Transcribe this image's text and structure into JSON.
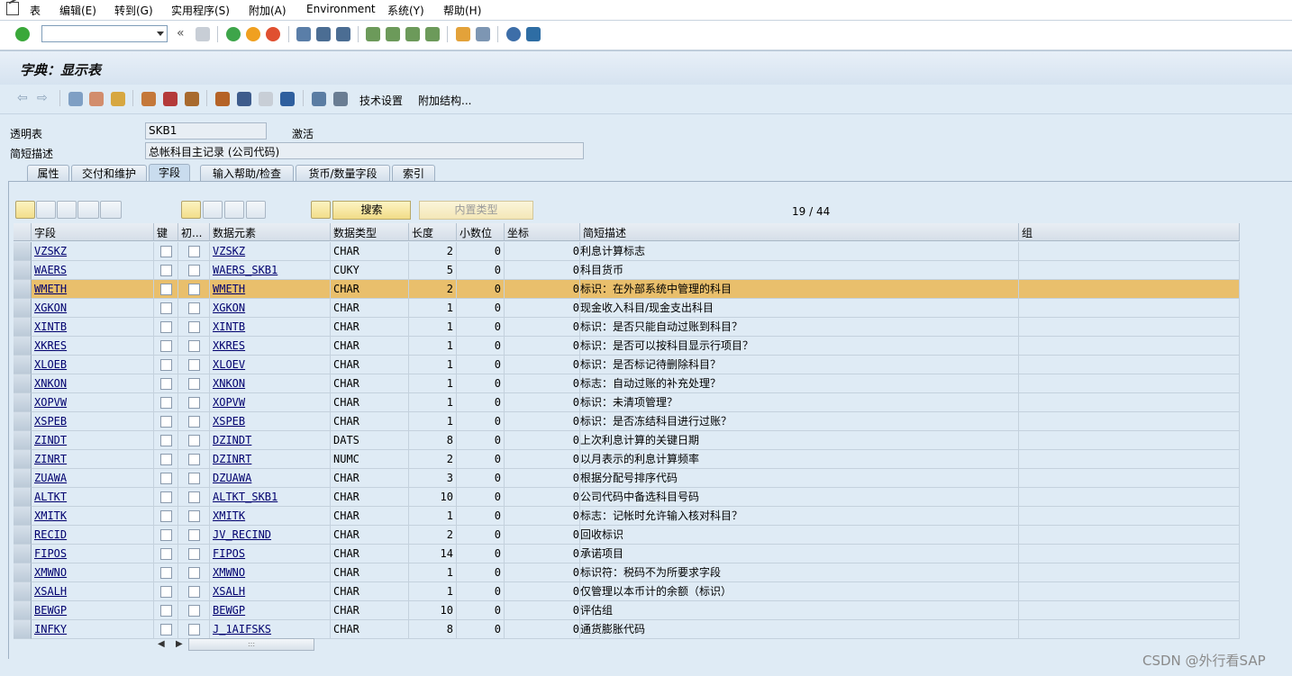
{
  "menubar": {
    "items": [
      "表",
      "编辑(E)",
      "转到(G)",
      "实用程序(S)",
      "附加(A)",
      "Environment",
      "系统(Y)",
      "帮助(H)"
    ]
  },
  "title": "字典：显示表",
  "app_toolbar": {
    "tech_settings": "技术设置",
    "append_struct": "附加结构..."
  },
  "header": {
    "table_label": "透明表",
    "table_value": "SKB1",
    "status": "激活",
    "desc_label": "简短描述",
    "desc_value": "总帐科目主记录 (公司代码)"
  },
  "tabs": [
    "属性",
    "交付和维护",
    "字段",
    "输入帮助/检查",
    "货币/数量字段",
    "索引"
  ],
  "active_tab": "字段",
  "table_toolbar": {
    "search": "搜索",
    "builtin_type": "内置类型",
    "counter": "19 / 44"
  },
  "columns": [
    "字段",
    "键",
    "初...",
    "数据元素",
    "数据类型",
    "长度",
    "小数位",
    "坐标",
    "简短描述",
    "组"
  ],
  "rows": [
    {
      "field": "VZSKZ",
      "element": "VZSKZ",
      "type": "CHAR",
      "len": "2",
      "dec": "0",
      "coord": "0",
      "desc": "利息计算标志"
    },
    {
      "field": "WAERS",
      "element": "WAERS_SKB1",
      "type": "CUKY",
      "len": "5",
      "dec": "0",
      "coord": "0",
      "desc": "科目货币"
    },
    {
      "field": "WMETH",
      "element": "WMETH",
      "type": "CHAR",
      "len": "2",
      "dec": "0",
      "coord": "0",
      "desc": "标识：在外部系统中管理的科目",
      "selected": true
    },
    {
      "field": "XGKON",
      "element": "XGKON",
      "type": "CHAR",
      "len": "1",
      "dec": "0",
      "coord": "0",
      "desc": "现金收入科目/现金支出科目"
    },
    {
      "field": "XINTB",
      "element": "XINTB",
      "type": "CHAR",
      "len": "1",
      "dec": "0",
      "coord": "0",
      "desc": "标识：是否只能自动过账到科目？"
    },
    {
      "field": "XKRES",
      "element": "XKRES",
      "type": "CHAR",
      "len": "1",
      "dec": "0",
      "coord": "0",
      "desc": "标识：是否可以按科目显示行项目？"
    },
    {
      "field": "XLOEB",
      "element": "XLOEV",
      "type": "CHAR",
      "len": "1",
      "dec": "0",
      "coord": "0",
      "desc": "标识：是否标记待删除科目？"
    },
    {
      "field": "XNKON",
      "element": "XNKON",
      "type": "CHAR",
      "len": "1",
      "dec": "0",
      "coord": "0",
      "desc": "标志：自动过账的补充处理？"
    },
    {
      "field": "XOPVW",
      "element": "XOPVW",
      "type": "CHAR",
      "len": "1",
      "dec": "0",
      "coord": "0",
      "desc": "标识：未清项管理？"
    },
    {
      "field": "XSPEB",
      "element": "XSPEB",
      "type": "CHAR",
      "len": "1",
      "dec": "0",
      "coord": "0",
      "desc": "标识：是否冻结科目进行过账？"
    },
    {
      "field": "ZINDT",
      "element": "DZINDT",
      "type": "DATS",
      "len": "8",
      "dec": "0",
      "coord": "0",
      "desc": "上次利息计算的关键日期"
    },
    {
      "field": "ZINRT",
      "element": "DZINRT",
      "type": "NUMC",
      "len": "2",
      "dec": "0",
      "coord": "0",
      "desc": "以月表示的利息计算频率"
    },
    {
      "field": "ZUAWA",
      "element": "DZUAWA",
      "type": "CHAR",
      "len": "3",
      "dec": "0",
      "coord": "0",
      "desc": "根据分配号排序代码"
    },
    {
      "field": "ALTKT",
      "element": "ALTKT_SKB1",
      "type": "CHAR",
      "len": "10",
      "dec": "0",
      "coord": "0",
      "desc": "公司代码中备选科目号码"
    },
    {
      "field": "XMITK",
      "element": "XMITK",
      "type": "CHAR",
      "len": "1",
      "dec": "0",
      "coord": "0",
      "desc": "标志：记帐时允许输入核对科目？"
    },
    {
      "field": "RECID",
      "element": "JV_RECIND",
      "type": "CHAR",
      "len": "2",
      "dec": "0",
      "coord": "0",
      "desc": "回收标识"
    },
    {
      "field": "FIPOS",
      "element": "FIPOS",
      "type": "CHAR",
      "len": "14",
      "dec": "0",
      "coord": "0",
      "desc": "承诺项目"
    },
    {
      "field": "XMWNO",
      "element": "XMWNO",
      "type": "CHAR",
      "len": "1",
      "dec": "0",
      "coord": "0",
      "desc": "标识符：税码不为所要求字段"
    },
    {
      "field": "XSALH",
      "element": "XSALH",
      "type": "CHAR",
      "len": "1",
      "dec": "0",
      "coord": "0",
      "desc": "仅管理以本币计的余额（标识）"
    },
    {
      "field": "BEWGP",
      "element": "BEWGP",
      "type": "CHAR",
      "len": "10",
      "dec": "0",
      "coord": "0",
      "desc": "评估组"
    },
    {
      "field": "INFKY",
      "element": "J_1AIFSKS",
      "type": "CHAR",
      "len": "8",
      "dec": "0",
      "coord": "0",
      "desc": "通货膨胀代码"
    }
  ],
  "watermark": "CSDN @外行看SAP",
  "colors": {
    "background": "#dfebf5",
    "selected_row": "#e9bf6c",
    "button": "#f2de8a"
  }
}
